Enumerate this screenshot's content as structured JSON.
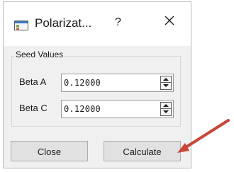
{
  "window": {
    "title": "Polarizat...",
    "help_label": "?",
    "icon": "app-window-icon",
    "close_icon": "close-icon"
  },
  "seed_values": {
    "group_title": "Seed Values",
    "beta_a": {
      "label": "Beta A",
      "value": "0.12000"
    },
    "beta_c": {
      "label": "Beta C",
      "value": "0.12000"
    }
  },
  "buttons": {
    "close_label": "Close",
    "calculate_label": "Calculate"
  },
  "annotation": {
    "type": "arrow",
    "color": "#c9453a",
    "points_to": "calculate-button"
  },
  "colors": {
    "dialog_bg": "#f0f0f0",
    "button_bg": "#e1e1e1",
    "accent": "#3a78c2"
  }
}
